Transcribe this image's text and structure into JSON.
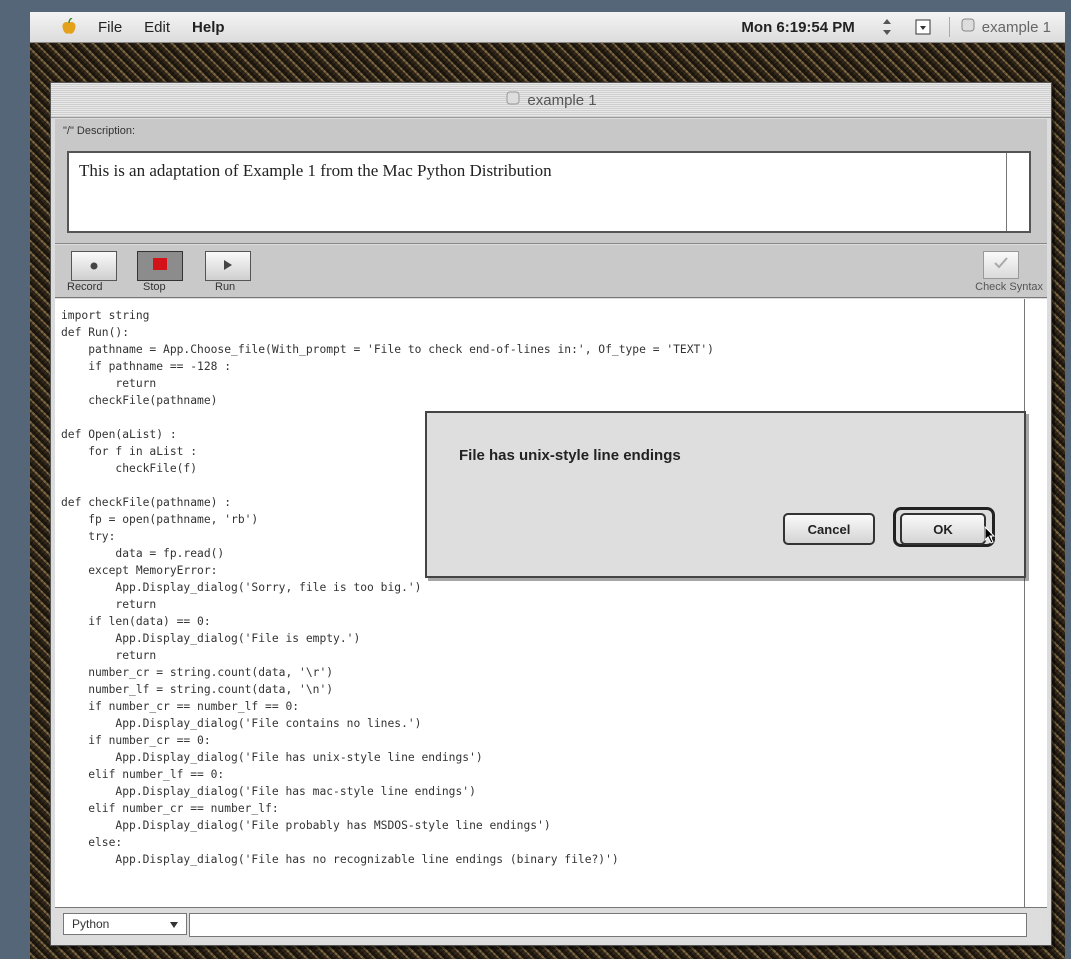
{
  "menubar": {
    "items": [
      "File",
      "Edit",
      "Help"
    ],
    "clock": "Mon 6:19:54 PM",
    "app_name": "example 1"
  },
  "window": {
    "title": "example 1"
  },
  "description": {
    "label": "\"/\" Description:",
    "text": "This is an adaptation of Example 1 from the Mac Python Distribution"
  },
  "toolbar": {
    "record_label": "Record",
    "stop_label": "Stop",
    "run_label": "Run",
    "check_label": "Check Syntax"
  },
  "editor": {
    "code": "import string\ndef Run():\n    pathname = App.Choose_file(With_prompt = 'File to check end-of-lines in:', Of_type = 'TEXT')\n    if pathname == -128 :\n        return\n    checkFile(pathname)\n\ndef Open(aList) :\n    for f in aList :\n        checkFile(f)\n\ndef checkFile(pathname) :\n    fp = open(pathname, 'rb')\n    try:\n        data = fp.read()\n    except MemoryError:\n        App.Display_dialog('Sorry, file is too big.')\n        return\n    if len(data) == 0:\n        App.Display_dialog('File is empty.')\n        return\n    number_cr = string.count(data, '\\r')\n    number_lf = string.count(data, '\\n')\n    if number_cr == number_lf == 0:\n        App.Display_dialog('File contains no lines.')\n    if number_cr == 0:\n        App.Display_dialog('File has unix-style line endings')\n    elif number_lf == 0:\n        App.Display_dialog('File has mac-style line endings')\n    elif number_cr == number_lf:\n        App.Display_dialog('File probably has MSDOS-style line endings')\n    else:\n        App.Display_dialog('File has no recognizable line endings (binary file?)')"
  },
  "statusbar": {
    "language": "Python"
  },
  "alert": {
    "message": "File has unix-style line endings",
    "cancel_label": "Cancel",
    "ok_label": "OK"
  },
  "colors": {
    "desktop": "#556678",
    "stop_red": "#d4121a"
  }
}
